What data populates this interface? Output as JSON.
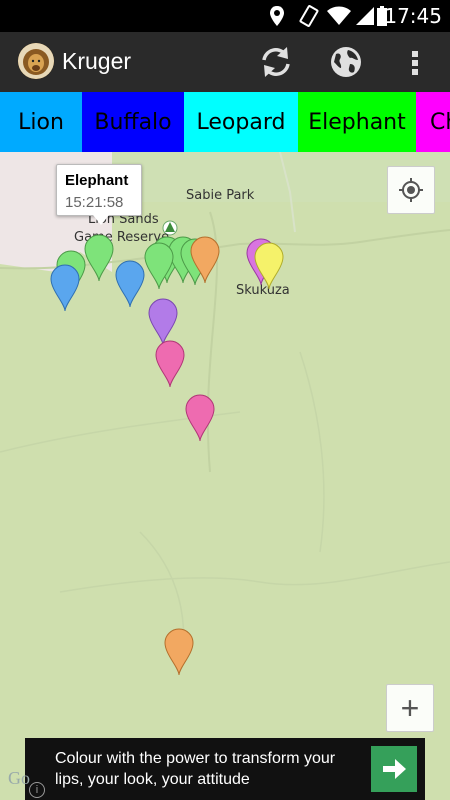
{
  "status_bar": {
    "time": "17:45"
  },
  "app_bar": {
    "title": "Kruger",
    "icons": [
      "lion-avatar",
      "refresh-icon",
      "globe-icon",
      "overflow-menu-icon"
    ]
  },
  "tabs": [
    {
      "label": "Lion",
      "color": "#00aaff"
    },
    {
      "label": "Buffalo",
      "color": "#0000ff"
    },
    {
      "label": "Leopard",
      "color": "#00ffff"
    },
    {
      "label": "Elephant",
      "color": "#00ff00"
    },
    {
      "label": "Ch",
      "color": "#ff00ff"
    }
  ],
  "map": {
    "labels": {
      "sabie_park": "Sabie Park",
      "skukuza": "Skukuza",
      "lion_sands": "Lion Sands",
      "game_reserve": "Game Reserve"
    },
    "info_window": {
      "title": "Elephant",
      "time": "15:21:58"
    },
    "marker_colors": {
      "green": "#7ee37a",
      "blue": "#5aa6ee",
      "orange": "#f2a861",
      "purple": "#b27be8",
      "pink": "#ee6bb0",
      "magenta": "#d974e0",
      "yellow": "#f5f26a"
    },
    "controls": {
      "zoom_in": "+"
    }
  },
  "ad": {
    "text": "Colour with the power to transform your lips, your look, your attitude"
  },
  "watermark": "Go"
}
